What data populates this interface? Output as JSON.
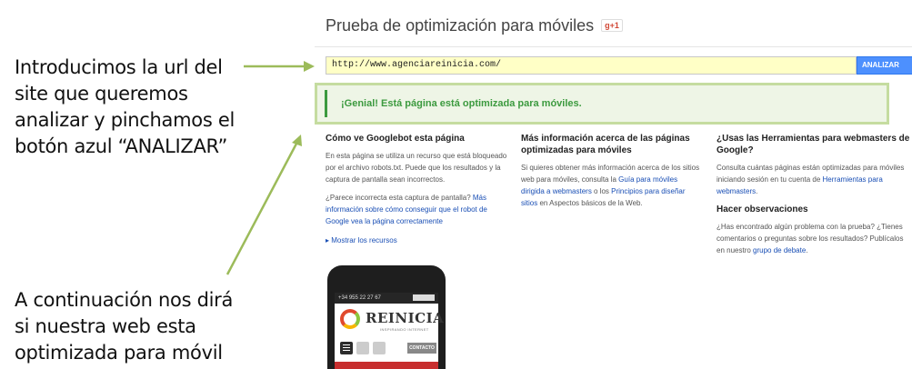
{
  "annotations": {
    "top": [
      "Introducimos la url del",
      "site que queremos",
      "analizar y pinchamos el",
      "botón azul “ANALIZAR”"
    ],
    "bottom": [
      "A continuación nos dirá",
      "si nuestra web esta",
      "optimizada para móvil"
    ]
  },
  "colors": {
    "arrow": "#9cbb5a",
    "accent_button": "#4d90fe",
    "success": "#3c9a3f",
    "input_bg": "#ffffc6"
  },
  "page": {
    "title": "Prueba de optimización para móviles",
    "gplus_label": "g+1"
  },
  "form": {
    "url_value": "http://www.agenciareinicia.com/",
    "analyze_label": "ANALIZAR"
  },
  "result": {
    "message": "¡Genial! Está página está optimizada para móviles."
  },
  "columns": {
    "googlebot": {
      "heading": "Cómo ve Googlebot esta página",
      "p1": "En esta página se utiliza un recurso que está bloqueado por el archivo robots.txt. Puede que los resultados y la captura de pantalla sean incorrectos.",
      "p2_text": "¿Parece incorrecta esta captura de pantalla? ",
      "p2_link": "Más información sobre cómo conseguir que el robot de Google vea la página correctamente",
      "show_resources": "▸ Mostrar los recursos"
    },
    "more_info": {
      "heading": "Más información acerca de las páginas optimizadas para móviles",
      "t1": "Si quieres obtener más información acerca de los sitios web para móviles, consulta la ",
      "l1": "Guía para móviles dirigida a webmasters",
      "t2": " o los ",
      "l2": "Principios para diseñar sitios",
      "t3": " en Aspectos básicos de la Web."
    },
    "tools": {
      "heading": "¿Usas las Herramientas para webmasters de Google?",
      "t1": "Consulta cuántas páginas están optimizadas para móviles iniciando sesión en tu cuenta de ",
      "l1": "Herramientas para webmasters",
      "t2": ".",
      "heading2": "Hacer observaciones",
      "t3": "¿Has encontrado algún problema con la prueba? ¿Tienes comentarios o preguntas sobre los resultados? Publícalos en nuestro ",
      "l2": "grupo de debate",
      "t4": "."
    }
  },
  "phone": {
    "phone_number": "+34 955 22 27 67",
    "logo_text": "REINICIA",
    "logo_tagline": "INSPIRANDO INTERNET",
    "contact_label": "CONTACTO"
  }
}
